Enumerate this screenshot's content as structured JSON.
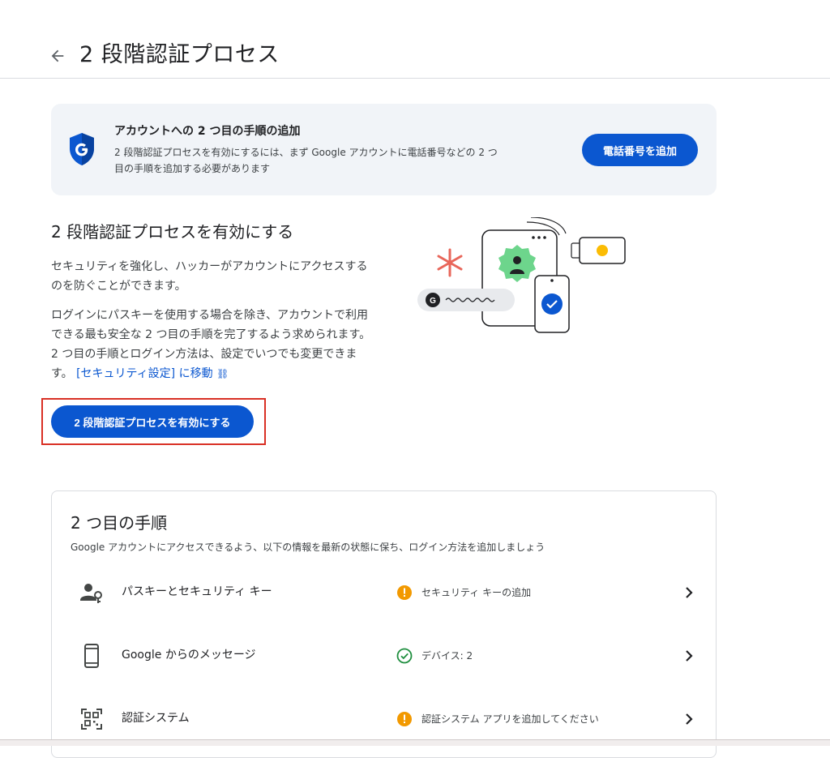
{
  "header": {
    "title": "2 段階認証プロセス",
    "back_icon": "arrow-left-icon"
  },
  "banner": {
    "title": "アカウントへの 2 つ目の手順の追加",
    "text": "2 段階認証プロセスを有効にするには、まず Google アカウントに電話番号などの 2 つ目の手順を追加する必要があります",
    "button_label": "電話番号を追加",
    "icon": "google-shield-icon"
  },
  "enable": {
    "title": "2 段階認証プロセスを有効にする",
    "p1": "セキュリティを強化し、ハッカーがアカウントにアクセスするのを防ぐことができます。",
    "p2": "ログインにパスキーを使用する場合を除き、アカウントで利用できる最も安全な 2 つ目の手順を完了するよう求められます。2 つ目の手順とログイン方法は、設定でいつでも変更できます。",
    "link_text": "[セキュリティ設定] に移動",
    "link_icon": "link-icon",
    "button_label": "2 段階認証プロセスを有効にする"
  },
  "steps": {
    "title": "2 つ目の手順",
    "subtitle": "Google アカウントにアクセスできるよう、以下の情報を最新の状態に保ち、ログイン方法を追加しましょう",
    "items": [
      {
        "label": "パスキーとセキュリティ キー",
        "status": "セキュリティ キーの追加",
        "status_type": "warning",
        "icon": "person-key-icon"
      },
      {
        "label": "Google からのメッセージ",
        "status": "デバイス: 2",
        "status_type": "ok",
        "icon": "phone-icon"
      },
      {
        "label": "認証システム",
        "status": "認証システム アプリを追加してください",
        "status_type": "warning",
        "icon": "qr-code-icon"
      }
    ]
  },
  "colors": {
    "primary": "#0b57d0",
    "warning": "#f29900",
    "ok": "#1e8e3e",
    "highlight": "#d93025"
  }
}
